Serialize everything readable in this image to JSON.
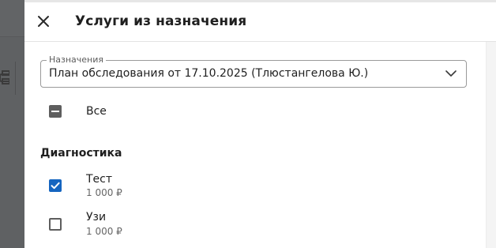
{
  "drawer": {
    "title": "Услуги из назначения"
  },
  "assignment_select": {
    "legend": "Назначения",
    "value": "План обследования от 17.10.2025 (Тлюстангелова Ю.)"
  },
  "select_all": {
    "label": "Все",
    "state": "indeterminate"
  },
  "sections": [
    {
      "title": "Диагностика",
      "services": [
        {
          "name": "Тест",
          "price": "1 000 ₽",
          "checked": true
        },
        {
          "name": "Узи",
          "price": "1 000 ₽",
          "checked": false
        }
      ]
    }
  ],
  "colors": {
    "accent": "#1565c0",
    "backdrop": "#5f6163"
  }
}
